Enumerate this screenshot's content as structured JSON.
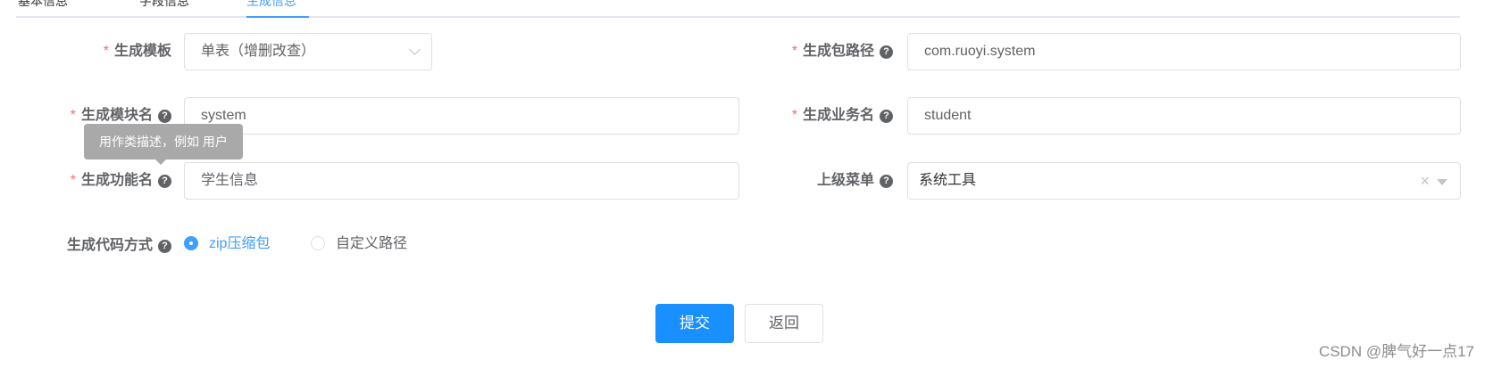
{
  "tabs": [
    "基本信息",
    "字段信息",
    "生成信息"
  ],
  "form": {
    "template": {
      "label": "生成模板",
      "value": "单表（增删改查）"
    },
    "package_path": {
      "label": "生成包路径",
      "value": "com.ruoyi.system"
    },
    "module_name": {
      "label": "生成模块名",
      "value": "system"
    },
    "business_name": {
      "label": "生成业务名",
      "value": "student"
    },
    "function_name": {
      "label": "生成功能名",
      "value": "学生信息"
    },
    "parent_menu": {
      "label": "上级菜单",
      "value": "系统工具"
    },
    "gen_type": {
      "label": "生成代码方式",
      "options": [
        "zip压缩包",
        "自定义路径"
      ],
      "selected": "zip压缩包"
    },
    "required_mark": "*",
    "help_icon": "question-circle-icon"
  },
  "tooltip": "用作类描述，例如 用户",
  "buttons": {
    "submit": "提交",
    "back": "返回"
  },
  "watermark": "CSDN @脾气好一点17",
  "colors": {
    "primary": "#1890ff",
    "link": "#409eff",
    "required": "#f56c6c",
    "tooltip": "#a9a9a9"
  }
}
